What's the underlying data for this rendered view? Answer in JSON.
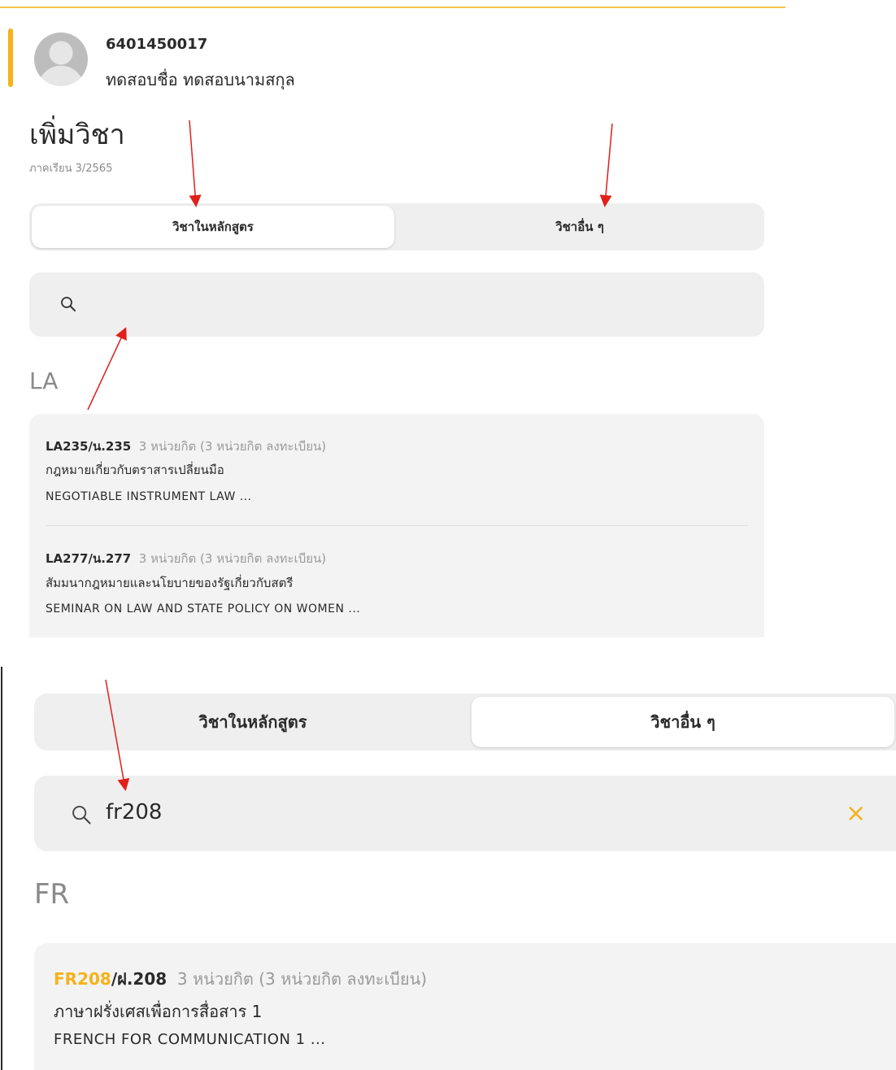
{
  "student": {
    "id": "6401450017",
    "name": "ทดสอบชื่อ ทดสอบนามสกุล"
  },
  "page": {
    "title": "เพิ่มวิชา",
    "term": "ภาคเรียน 3/2565"
  },
  "tabs": [
    {
      "label": "วิชาในหลักสูตร"
    },
    {
      "label": "วิชาอื่น ๆ"
    }
  ],
  "panel1": {
    "search_value": "",
    "group": "LA",
    "courses": [
      {
        "code": "LA235/น.235",
        "credits": "3 หน่วยกิต (3 หน่วยกิต ลงทะเบียน)",
        "name_th": "กฎหมายเกี่ยวกับตราสารเปลี่ยนมือ",
        "name_en": "NEGOTIABLE INSTRUMENT LAW ..."
      },
      {
        "code": "LA277/น.277",
        "credits": "3 หน่วยกิต (3 หน่วยกิต ลงทะเบียน)",
        "name_th": "สัมมนากฎหมายและนโยบายของรัฐเกี่ยวกับสตรี",
        "name_en": "SEMINAR ON LAW AND STATE POLICY ON WOMEN ..."
      }
    ]
  },
  "panel2": {
    "search_value": "fr208",
    "clear_icon": "×",
    "group": "FR",
    "courses": [
      {
        "code_match": "FR208",
        "code_rest": "/ฝ.208",
        "credits": "3 หน่วยกิต (3 หน่วยกิต ลงทะเบียน)",
        "name_th": "ภาษาฝรั่งเศสเพื่อการสื่อสาร 1",
        "name_en": "FRENCH FOR COMMUNICATION 1 ..."
      }
    ]
  },
  "colors": {
    "accent": "#f5b21a",
    "annotation_arrow": "#e0201a"
  },
  "icons": [
    "avatar-icon",
    "search-icon",
    "close-icon"
  ]
}
